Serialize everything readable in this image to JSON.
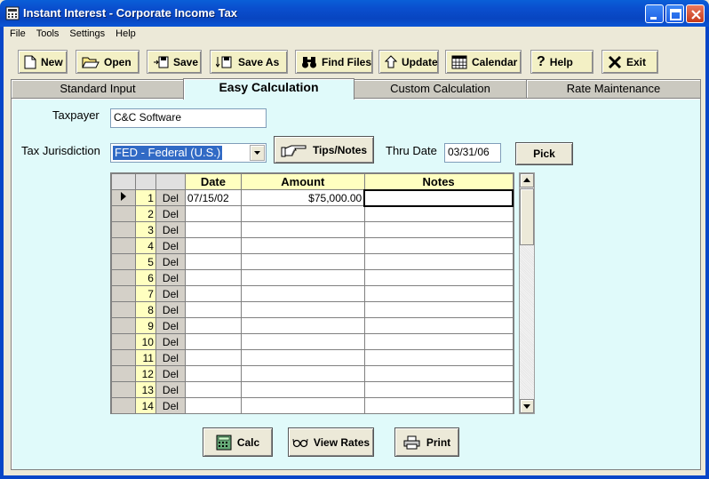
{
  "window": {
    "title": "Instant Interest - Corporate Income Tax"
  },
  "menu": [
    "File",
    "Tools",
    "Settings",
    "Help"
  ],
  "toolbar": {
    "new": "New",
    "open": "Open",
    "save": "Save",
    "save_as": "Save As",
    "find_files": "Find Files",
    "update": "Update",
    "calendar": "Calendar",
    "help": "Help",
    "exit": "Exit"
  },
  "tabs": [
    "Standard Input",
    "Easy Calculation",
    "Custom Calculation",
    "Rate Maintenance"
  ],
  "active_tab": "Easy Calculation",
  "form": {
    "taxpayer_label": "Taxpayer",
    "taxpayer_value": "C&C Software",
    "jurisdiction_label": "Tax Jurisdiction",
    "jurisdiction_value": "FED - Federal (U.S.)",
    "tips_button": "Tips/Notes",
    "thru_date_label": "Thru Date",
    "thru_date_value": "03/31/06",
    "pick_button": "Pick"
  },
  "grid": {
    "headers": {
      "date": "Date",
      "amount": "Amount",
      "notes": "Notes"
    },
    "rows": [
      {
        "num": "1",
        "del": "Del",
        "date": "07/15/02",
        "amount": "$75,000.00",
        "notes": ""
      },
      {
        "num": "2",
        "del": "Del",
        "date": "",
        "amount": "",
        "notes": ""
      },
      {
        "num": "3",
        "del": "Del",
        "date": "",
        "amount": "",
        "notes": ""
      },
      {
        "num": "4",
        "del": "Del",
        "date": "",
        "amount": "",
        "notes": ""
      },
      {
        "num": "5",
        "del": "Del",
        "date": "",
        "amount": "",
        "notes": ""
      },
      {
        "num": "6",
        "del": "Del",
        "date": "",
        "amount": "",
        "notes": ""
      },
      {
        "num": "7",
        "del": "Del",
        "date": "",
        "amount": "",
        "notes": ""
      },
      {
        "num": "8",
        "del": "Del",
        "date": "",
        "amount": "",
        "notes": ""
      },
      {
        "num": "9",
        "del": "Del",
        "date": "",
        "amount": "",
        "notes": ""
      },
      {
        "num": "10",
        "del": "Del",
        "date": "",
        "amount": "",
        "notes": ""
      },
      {
        "num": "11",
        "del": "Del",
        "date": "",
        "amount": "",
        "notes": ""
      },
      {
        "num": "12",
        "del": "Del",
        "date": "",
        "amount": "",
        "notes": ""
      },
      {
        "num": "13",
        "del": "Del",
        "date": "",
        "amount": "",
        "notes": ""
      },
      {
        "num": "14",
        "del": "Del",
        "date": "",
        "amount": "",
        "notes": ""
      }
    ]
  },
  "actions": {
    "calc": "Calc",
    "view_rates": "View Rates",
    "print": "Print"
  },
  "colors": {
    "panel_bg": "#e0fafa",
    "toolbar_button_bg": "#f3f0c5",
    "grid_header_bg": "#ffffc0",
    "titlebar_blue": "#0a55d5"
  }
}
